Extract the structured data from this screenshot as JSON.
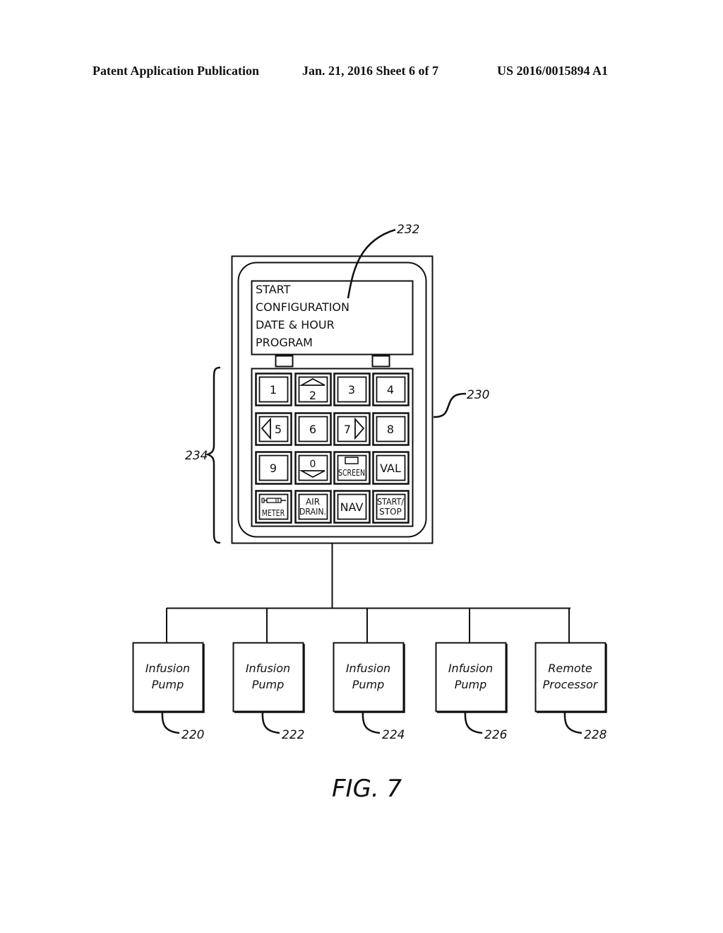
{
  "header": {
    "left": "Patent Application Publication",
    "middle": "Jan. 21, 2016   Sheet 6 of 7",
    "right": "US 2016/0015894 A1"
  },
  "device": {
    "ref": "230",
    "screen_ref": "232",
    "keypad_ref": "234",
    "screen_lines": [
      "START",
      "CONFIGURATION",
      "DATE & HOUR",
      "PROGRAM"
    ],
    "keys": [
      {
        "label": "1",
        "icon": ""
      },
      {
        "label": "2",
        "icon": "up-arrow-icon"
      },
      {
        "label": "3",
        "icon": ""
      },
      {
        "label": "4",
        "icon": ""
      },
      {
        "label": "5",
        "icon": "left-arrow-icon"
      },
      {
        "label": "6",
        "icon": ""
      },
      {
        "label": "7",
        "icon": "right-arrow-icon"
      },
      {
        "label": "8",
        "icon": ""
      },
      {
        "label": "9",
        "icon": ""
      },
      {
        "label": "0",
        "icon": "down-arrow-icon"
      },
      {
        "label": "SCREEN",
        "icon": "screen-icon"
      },
      {
        "label": "VAL",
        "icon": ""
      },
      {
        "label": "METER",
        "icon": "syringe-icon"
      },
      {
        "label": "AIR\nDRAIN.",
        "icon": ""
      },
      {
        "label": "NAV",
        "icon": ""
      },
      {
        "label": "START/\nSTOP",
        "icon": ""
      }
    ]
  },
  "nodes": [
    {
      "line1": "Infusion",
      "line2": "Pump",
      "ref": "220"
    },
    {
      "line1": "Infusion",
      "line2": "Pump",
      "ref": "222"
    },
    {
      "line1": "Infusion",
      "line2": "Pump",
      "ref": "224"
    },
    {
      "line1": "Infusion",
      "line2": "Pump",
      "ref": "226"
    },
    {
      "line1": "Remote",
      "line2": "Processor",
      "ref": "228"
    }
  ],
  "figure_label": "FIG. 7"
}
